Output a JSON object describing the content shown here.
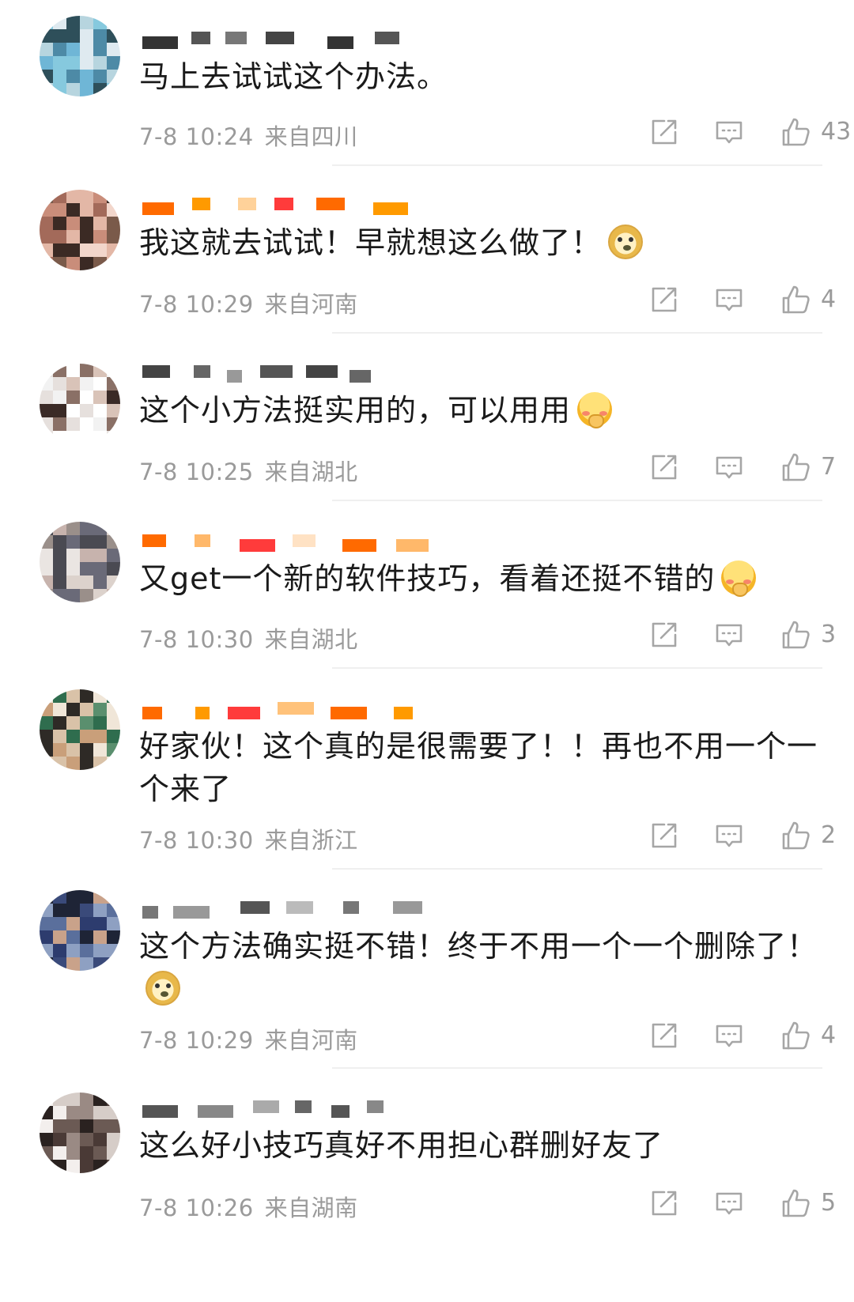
{
  "comments": [
    {
      "text": "马上去试试这个办法。",
      "emoji": "",
      "time": "7-8 10:24",
      "location": "来自四川",
      "likes": "43"
    },
    {
      "text": "我这就去试试！早就想这么做了！",
      "emoji": "doge",
      "time": "7-8 10:29",
      "location": "来自河南",
      "likes": "4"
    },
    {
      "text": "这个小方法挺实用的，可以用用",
      "emoji": "shy",
      "time": "7-8 10:25",
      "location": "来自湖北",
      "likes": "7"
    },
    {
      "text": "又get一个新的软件技巧，看着还挺不错的",
      "emoji": "shy",
      "time": "7-8 10:30",
      "location": "来自湖北",
      "likes": "3"
    },
    {
      "text": "好家伙！这个真的是很需要了！！再也不用一个一个来了",
      "emoji": "",
      "time": "7-8 10:30",
      "location": "来自浙江",
      "likes": "2"
    },
    {
      "text": "这个方法确实挺不错！终于不用一个一个删除了！",
      "emoji": "doge",
      "time": "7-8 10:29",
      "location": "来自河南",
      "likes": "4"
    },
    {
      "text": "这么好小技巧真好不用担心群删好友了",
      "emoji": "",
      "time": "7-8 10:26",
      "location": "来自湖南",
      "likes": "5"
    }
  ],
  "icons": {
    "share": "share-icon",
    "reply": "comment-icon",
    "like": "thumbs-up-icon"
  },
  "colors": {
    "meta": "#9a9a9a",
    "text": "#1a1a1a",
    "divider": "#efefef"
  }
}
